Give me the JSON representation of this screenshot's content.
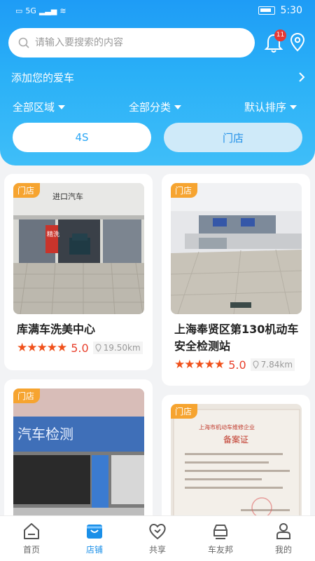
{
  "status": {
    "network": "5G",
    "time": "5:30"
  },
  "search": {
    "placeholder": "请输入要搜索的内容"
  },
  "notifications": {
    "count": "11"
  },
  "add_car": {
    "label": "添加您的爱车"
  },
  "filters": [
    {
      "label": "全部区域"
    },
    {
      "label": "全部分类"
    },
    {
      "label": "默认排序"
    }
  ],
  "segments": [
    {
      "label": "4S",
      "selected": false
    },
    {
      "label": "门店",
      "selected": true
    }
  ],
  "stores": [
    {
      "tag": "门店",
      "name": "库满车洗美中心",
      "stars": "★★★★★",
      "score": "5.0",
      "distance": "19.50km",
      "sign_text": "进口汽车",
      "sign_text2": "精洗"
    },
    {
      "tag": "门店",
      "name": "上海奉贤区第130机动车安全检测站",
      "stars": "★★★★★",
      "score": "5.0",
      "distance": "7.84km"
    },
    {
      "tag": "门店",
      "name": "",
      "sign_text": "汽车检测"
    },
    {
      "tag": "门店",
      "name": "",
      "doc_title": "上海市机动车维修企业",
      "doc_heading": "备案证"
    }
  ],
  "tabs": [
    {
      "label": "首页",
      "icon": "home-icon",
      "active": false
    },
    {
      "label": "店铺",
      "icon": "store-icon",
      "active": true
    },
    {
      "label": "共享",
      "icon": "share-heart-icon",
      "active": false
    },
    {
      "label": "车友邦",
      "icon": "car-club-icon",
      "active": false
    },
    {
      "label": "我的",
      "icon": "profile-icon",
      "active": false
    }
  ],
  "colors": {
    "primary": "#1e9cf6",
    "accent_orange": "#f6a430",
    "star_red": "#f0511b"
  }
}
